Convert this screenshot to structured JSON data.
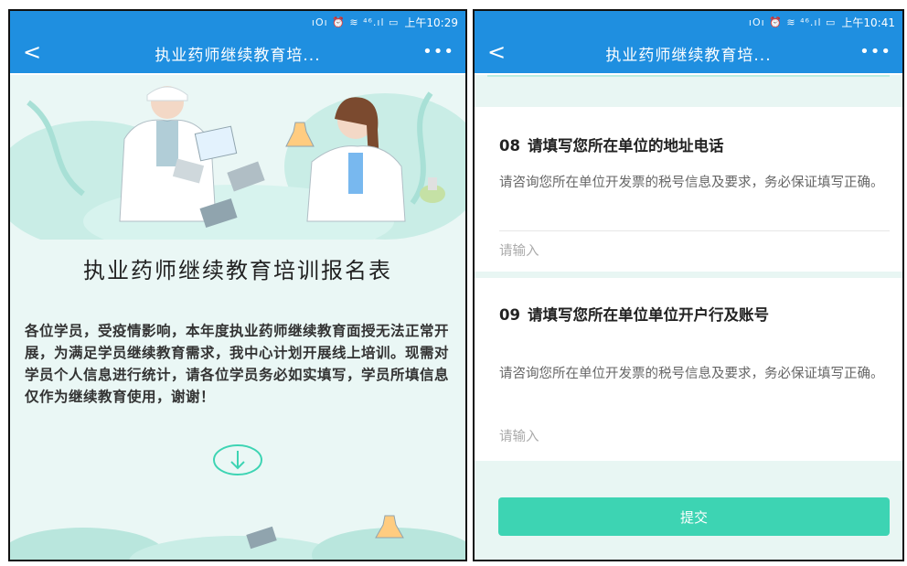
{
  "left": {
    "status": {
      "icons": "ıOı ⏰ ≋ ⁴⁶.ıl ▭",
      "time": "上午10:29"
    },
    "nav": {
      "back": "<",
      "title": "执业药师继续教育培...",
      "more": "•••"
    },
    "form": {
      "title": "执业药师继续教育培训报名表",
      "description": "各位学员，受疫情影响，本年度执业药师继续教育面授无法正常开展，为满足学员继续教育需求，我中心计划开展线上培训。现需对学员个人信息进行统计，请各位学员务必如实填写，学员所填信息仅作为继续教育使用，谢谢！"
    },
    "icons": {
      "down": "arrow-down-circle-icon"
    }
  },
  "right": {
    "status": {
      "icons": "ıOı ⏰ ≋ ⁴⁶.ıl ▭",
      "time": "上午10:41"
    },
    "nav": {
      "back": "<",
      "title": "执业药师继续教育培...",
      "more": "•••"
    },
    "questions": [
      {
        "number": "08",
        "title": "请填写您所在单位的地址电话",
        "description": "请咨询您所在单位开发票的税号信息及要求，务必保证填写正确。",
        "placeholder": "请输入",
        "value": ""
      },
      {
        "number": "09",
        "title": "请填写您所在单位单位开户行及账号",
        "description": "请咨询您所在单位开发票的税号信息及要求，务必保证填写正确。",
        "placeholder": "请输入",
        "value": ""
      }
    ],
    "submit_label": "提交"
  },
  "colors": {
    "navbar": "#1f8fe0",
    "accent": "#3dd4b3",
    "page_bg": "#e8f6f3",
    "text": "#222222",
    "muted": "#666666"
  }
}
